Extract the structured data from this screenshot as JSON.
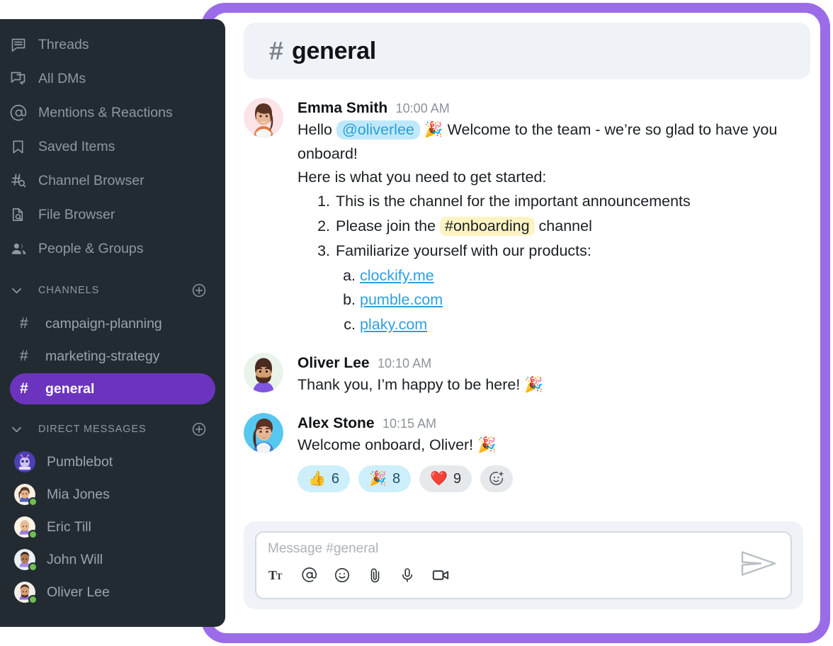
{
  "theme": {
    "frame_purple": "#9b6ce8",
    "sidebar_bg": "#232b32",
    "active_channel_bg": "#6c34be",
    "header_bg": "#eff3f7",
    "link_blue": "#2f9fe0",
    "mention_bg": "#bfe9fb",
    "channel_ref_bg": "#fdf3c2",
    "presence_green": "#6ec04f"
  },
  "sidebar": {
    "nav": [
      {
        "icon": "threads-icon",
        "label": "Threads"
      },
      {
        "icon": "all-dms-icon",
        "label": "All DMs"
      },
      {
        "icon": "mentions-icon",
        "label": "Mentions & Reactions"
      },
      {
        "icon": "bookmark-icon",
        "label": "Saved Items"
      },
      {
        "icon": "channel-browser-icon",
        "label": "Channel Browser"
      },
      {
        "icon": "file-browser-icon",
        "label": "File Browser"
      },
      {
        "icon": "people-icon",
        "label": "People & Groups"
      }
    ],
    "channels_section": {
      "title": "CHANNELS",
      "add_label": "+"
    },
    "channels": [
      {
        "name": "campaign-planning",
        "active": false
      },
      {
        "name": "marketing-strategy",
        "active": false
      },
      {
        "name": "general",
        "active": true
      }
    ],
    "dms_section": {
      "title": "DIRECT MESSAGES",
      "add_label": "+"
    },
    "dms": [
      {
        "name": "Pumblebot",
        "online": false,
        "avatar": "bot"
      },
      {
        "name": "Mia Jones",
        "online": true,
        "avatar": "mia"
      },
      {
        "name": "Eric Till",
        "online": true,
        "avatar": "eric"
      },
      {
        "name": "John Will",
        "online": true,
        "avatar": "john"
      },
      {
        "name": "Oliver Lee",
        "online": true,
        "avatar": "oliver"
      }
    ]
  },
  "channel_header": {
    "hash": "#",
    "name": "general"
  },
  "messages": {
    "m1": {
      "author": "Emma Smith",
      "time": "10:00 AM",
      "line1_a": "Hello ",
      "mention": "@oliverlee",
      "emoji": "🎉",
      "line1_b": " Welcome to the team - we’re so glad to have you onboard!",
      "line2": "Here is what you need to get started:",
      "item1": "This is the channel for the important announcements",
      "item2_a": "Please join the ",
      "item2_ref": "#onboarding",
      "item2_b": " channel",
      "item3": "Familiarize yourself with our products:",
      "sub_a": "clockify.me",
      "sub_b": "pumble.com",
      "sub_c": "plaky.com"
    },
    "m2": {
      "author": "Oliver Lee",
      "time": "10:10 AM",
      "text": "Thank you, I’m happy to be here! 🎉"
    },
    "m3": {
      "author": "Alex Stone",
      "time": "10:15 AM",
      "text": "Welcome onboard, Oliver! 🎉",
      "reactions": [
        {
          "emoji": "👍",
          "count": "6",
          "reacted": true,
          "name": "thumbs-up"
        },
        {
          "emoji": "🎉",
          "count": "8",
          "reacted": true,
          "name": "party-popper"
        },
        {
          "emoji": "❤️",
          "count": "9",
          "reacted": false,
          "name": "heart"
        }
      ],
      "add_reaction_label": "add-reaction"
    }
  },
  "composer": {
    "placeholder": "Message #general",
    "tools": [
      {
        "icon": "format-text-icon",
        "label": "Tt"
      },
      {
        "icon": "mention-icon",
        "label": "@"
      },
      {
        "icon": "emoji-icon",
        "label": "emoji"
      },
      {
        "icon": "attachment-icon",
        "label": "attach"
      },
      {
        "icon": "microphone-icon",
        "label": "audio"
      },
      {
        "icon": "video-icon",
        "label": "video"
      }
    ],
    "send_label": "send"
  }
}
